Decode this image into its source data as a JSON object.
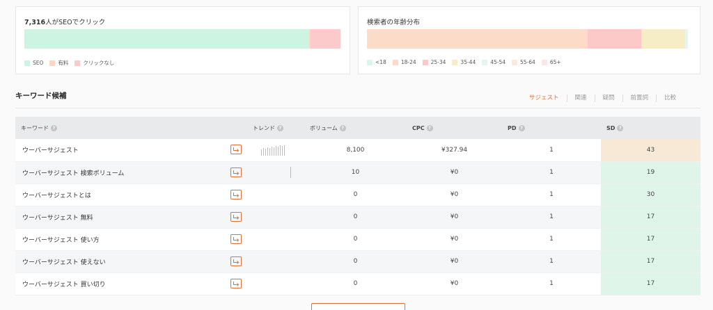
{
  "colors": {
    "accent": "#e0703b",
    "seo": "#cdf4e3",
    "paid": "#fcd6c1",
    "noclick": "#fccaca",
    "age_lt18": "#d8f6ea",
    "age_18_24": "#fcdcc8",
    "age_25_34": "#fcc8c8",
    "age_35_44": "#f6ecc6",
    "age_45_54": "#e3f7ef",
    "age_55_64": "#fde9dc",
    "age_65": "#fde6e6",
    "sd_high": "#f8e8d6",
    "sd_low": "#e0f5ea"
  },
  "click_card": {
    "title_count": "7,316",
    "title_text": "人がSEOでクリック",
    "segments": [
      {
        "name": "SEO",
        "share": 0.9,
        "color": "#cdf4e3"
      },
      {
        "name": "有料",
        "share": 0.005,
        "color": "#fcd6c1"
      },
      {
        "name": "クリックなし",
        "share": 0.095,
        "color": "#fccaca"
      }
    ],
    "legend": [
      "SEO",
      "有料",
      "クリックなし"
    ]
  },
  "age_card": {
    "title": "検索者の年齢分布",
    "segments": [
      {
        "name": "<18",
        "share": 0.0,
        "color": "#d8f6ea"
      },
      {
        "name": "18-24",
        "share": 0.68,
        "color": "#fcdcc8"
      },
      {
        "name": "25-34",
        "share": 0.165,
        "color": "#fcc8c8"
      },
      {
        "name": "35-44",
        "share": 0.135,
        "color": "#f6ecc6"
      },
      {
        "name": "45-54",
        "share": 0.01,
        "color": "#e3f7ef"
      },
      {
        "name": "55-64",
        "share": 0.0,
        "color": "#fde9dc"
      },
      {
        "name": "65+",
        "share": 0.0,
        "color": "#fde6e6"
      }
    ]
  },
  "section": {
    "title": "キーワード候補",
    "tabs": [
      "サジェスト",
      "関連",
      "疑問",
      "前置詞",
      "比較"
    ],
    "active_tab": "サジェスト"
  },
  "table": {
    "headers": {
      "keyword": "キーワード",
      "trend": "トレンド",
      "volume": "ボリューム",
      "cpc": "CPC",
      "pd": "PD",
      "sd": "SD"
    },
    "rows": [
      {
        "keyword": "ウーバーサジェスト",
        "trend": [
          9,
          11,
          10,
          12,
          11,
          13,
          12,
          14,
          13,
          15,
          14,
          15
        ],
        "volume": "8,100",
        "cpc": "¥327.94",
        "pd": "1",
        "sd": "43",
        "sd_level": "high"
      },
      {
        "keyword": "ウーバーサジェスト 検索ボリューム",
        "trend": [
          16
        ],
        "volume": "10",
        "cpc": "¥0",
        "pd": "1",
        "sd": "19",
        "sd_level": "low"
      },
      {
        "keyword": "ウーバーサジェストとは",
        "trend": [],
        "volume": "0",
        "cpc": "¥0",
        "pd": "1",
        "sd": "30",
        "sd_level": "low"
      },
      {
        "keyword": "ウーバーサジェスト 無料",
        "trend": [],
        "volume": "0",
        "cpc": "¥0",
        "pd": "1",
        "sd": "17",
        "sd_level": "low"
      },
      {
        "keyword": "ウーバーサジェスト 使い方",
        "trend": [],
        "volume": "0",
        "cpc": "¥0",
        "pd": "1",
        "sd": "17",
        "sd_level": "low"
      },
      {
        "keyword": "ウーバーサジェスト 使えない",
        "trend": [],
        "volume": "0",
        "cpc": "¥0",
        "pd": "1",
        "sd": "17",
        "sd_level": "low"
      },
      {
        "keyword": "ウーバーサジェスト 買い切り",
        "trend": [],
        "volume": "0",
        "cpc": "¥0",
        "pd": "1",
        "sd": "17",
        "sd_level": "low"
      }
    ]
  }
}
